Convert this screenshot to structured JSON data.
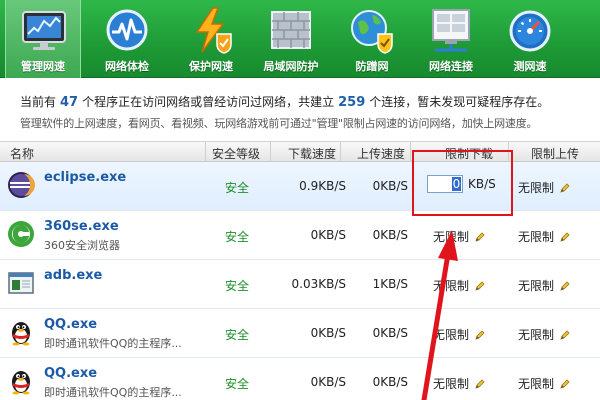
{
  "toolbar": {
    "items": [
      {
        "label": "管理网速",
        "icon": "monitor-chart-icon",
        "active": true
      },
      {
        "label": "网络体检",
        "icon": "heartbeat-icon"
      },
      {
        "label": "保护网速",
        "icon": "lightning-shield-icon"
      },
      {
        "label": "局域网防护",
        "icon": "brick-wall-icon"
      },
      {
        "label": "防蹭网",
        "icon": "globe-shield-icon"
      },
      {
        "label": "网络连接",
        "icon": "network-connection-icon"
      },
      {
        "label": "测网速",
        "icon": "speedometer-icon"
      }
    ]
  },
  "info": {
    "line1_a": "当前有",
    "program_count": "47",
    "line1_b": "个程序正在访问网络或曾经访问过网络，共建立",
    "connection_count": "259",
    "line1_c": "个连接，暂未发现可疑程序存在。",
    "line2": "管理软件的上网速度，看网页、看视频、玩网络游戏前可通过\"管理\"限制占网速的访问网络，加快上网速度。"
  },
  "table": {
    "headers": {
      "name": "名称",
      "security": "安全等级",
      "download": "下载速度",
      "upload": "上传速度",
      "limit_down": "限制下载",
      "limit_up": "限制上传"
    },
    "rows": [
      {
        "name": "eclipse.exe",
        "desc": "",
        "icon": "eclipse-icon",
        "security": "安全",
        "download": "0.9KB/S",
        "upload": "0KB/S",
        "limit_down": "0",
        "limit_down_unit": "KB/S",
        "limit_up": "无限制",
        "editing": true
      },
      {
        "name": "360se.exe",
        "desc": "360安全浏览器",
        "icon": "360-browser-icon",
        "security": "安全",
        "download": "0KB/S",
        "upload": "0KB/S",
        "limit_down": "无限制",
        "limit_up": "无限制"
      },
      {
        "name": "adb.exe",
        "desc": "",
        "icon": "window-app-icon",
        "security": "安全",
        "download": "0.03KB/S",
        "upload": "1KB/S",
        "limit_down": "无限制",
        "limit_up": "无限制"
      },
      {
        "name": "QQ.exe",
        "desc": "即时通讯软件QQ的主程序...",
        "icon": "qq-penguin-icon",
        "security": "安全",
        "download": "0KB/S",
        "upload": "0KB/S",
        "limit_down": "无限制",
        "limit_up": "无限制"
      },
      {
        "name": "QQ.exe",
        "desc": "即时通讯软件QQ的主程序...",
        "icon": "qq-penguin-icon",
        "security": "安全",
        "download": "0KB/S",
        "upload": "0KB/S",
        "limit_down": "无限制",
        "limit_up": "无限制"
      }
    ]
  },
  "colors": {
    "toolbar_green": "#1e9a36",
    "link_blue": "#1c5aa6",
    "safe_green": "#1f8f2a",
    "annotation_red": "#e0141d"
  }
}
